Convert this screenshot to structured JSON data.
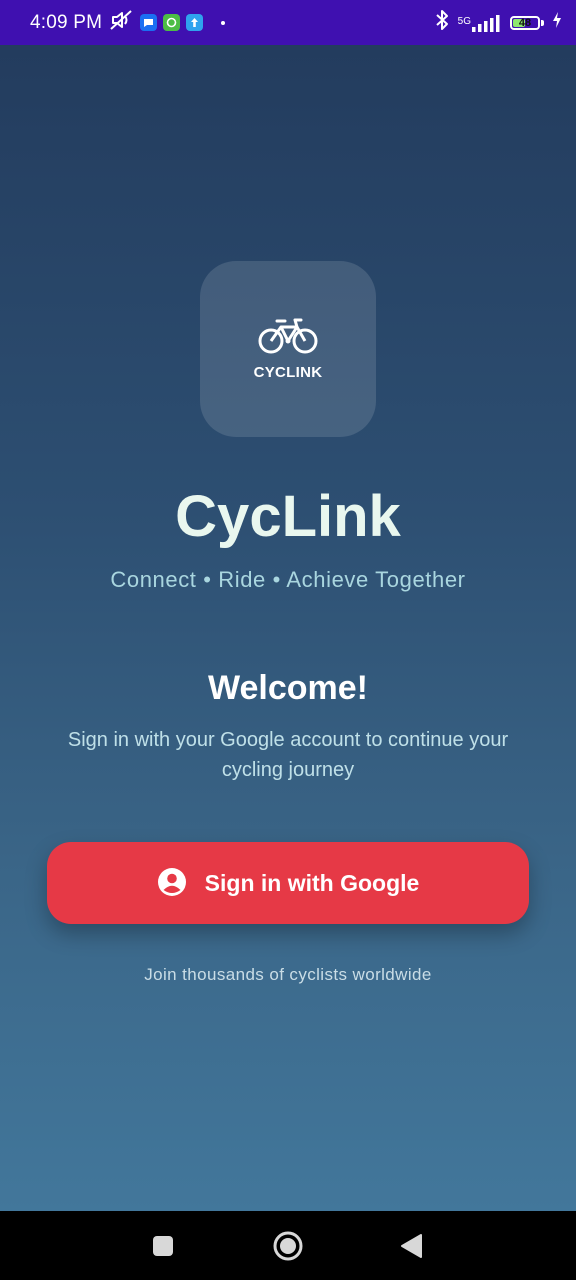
{
  "status_bar": {
    "time": "4:09 PM",
    "network": "5G",
    "battery_level": "48",
    "battery_fraction": 0.48,
    "icons": [
      "muted-icon",
      "message-app-icon",
      "chat-app-icon",
      "upload-app-icon",
      "bluetooth-icon",
      "signal-icon",
      "battery-icon",
      "charging-icon"
    ]
  },
  "logo": {
    "wordmark": "CYCLINK",
    "icon": "bicycle-icon"
  },
  "app_name": "CycLink",
  "tagline": "Connect • Ride • Achieve Together",
  "welcome": {
    "title": "Welcome!",
    "subtitle": "Sign in with your Google account to continue your cycling journey"
  },
  "sign_in": {
    "label": "Sign in with Google",
    "icon": "account-circle-icon"
  },
  "footer": "Join thousands of cyclists worldwide",
  "nav": {
    "icons": [
      "recents-square-icon",
      "home-circle-icon",
      "back-triangle-icon"
    ]
  },
  "colors": {
    "status_bar": "#3f10b0",
    "accent_button": "#e63946",
    "title": "#e9f7ef",
    "tagline": "#a9d6df"
  }
}
